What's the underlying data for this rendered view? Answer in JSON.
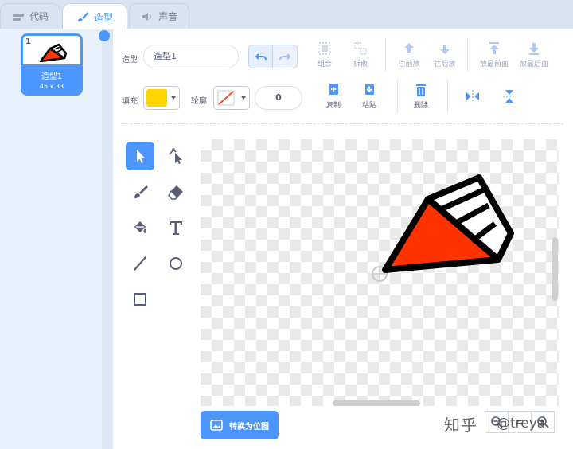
{
  "tabs": [
    {
      "label": "代码",
      "icon": "code-icon"
    },
    {
      "label": "造型",
      "icon": "brush-icon"
    },
    {
      "label": "声音",
      "icon": "speaker-icon"
    }
  ],
  "costume": {
    "number": "1",
    "name": "造型1",
    "size": "45 x 33"
  },
  "toolbar": {
    "costume_label": "造型",
    "costume_name": "造型1",
    "group": "组合",
    "ungroup": "拆散",
    "forward": "往前放",
    "backward": "往后放",
    "front": "放最前面",
    "back": "放最后面",
    "fill_label": "填充",
    "outline_label": "轮廓",
    "outline_width": "0",
    "copy": "复制",
    "paste": "粘贴",
    "delete": "删除"
  },
  "convert_button": "转换为位图",
  "watermark": {
    "brand": "知乎",
    "user": "@treya"
  },
  "colors": {
    "accent": "#4c97ff",
    "fill": "#ffd400",
    "shape_red": "#ff3300",
    "outline": "#000000"
  }
}
